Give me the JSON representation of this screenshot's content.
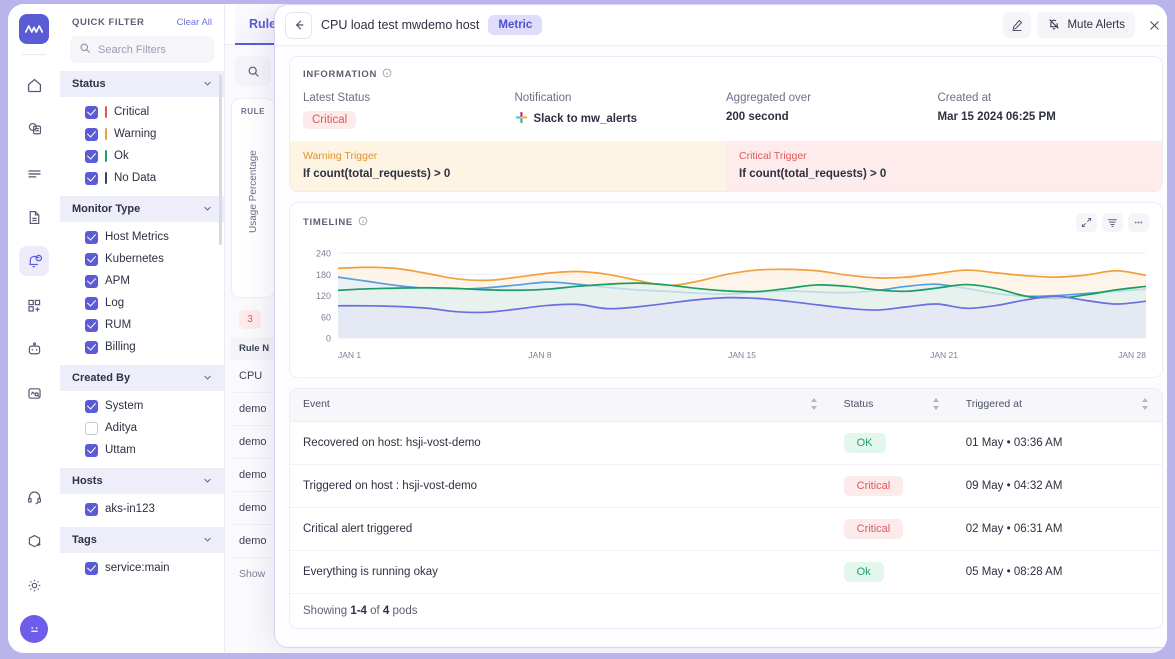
{
  "rail": {
    "logo": "mw-logo",
    "items": [
      {
        "name": "home-icon"
      },
      {
        "name": "infrastructure-icon"
      },
      {
        "name": "logs-icon"
      },
      {
        "name": "documents-icon"
      },
      {
        "name": "alerts-icon",
        "active": true
      },
      {
        "name": "add-widget-icon"
      },
      {
        "name": "bot-icon"
      },
      {
        "name": "synthetics-icon"
      }
    ],
    "bottom": [
      {
        "name": "support-headset-icon"
      },
      {
        "name": "add-package-icon"
      },
      {
        "name": "settings-gear-icon"
      }
    ],
    "avatar": "user-avatar"
  },
  "quick_filter": {
    "title": "QUICK FILTER",
    "clear_all": "Clear All",
    "search_placeholder": "Search Filters",
    "sections": [
      {
        "title": "Status",
        "items": [
          {
            "label": "Critical",
            "checked": true,
            "color": "#e0585b"
          },
          {
            "label": "Warning",
            "checked": true,
            "color": "#f0a132"
          },
          {
            "label": "Ok",
            "checked": true,
            "color": "#22a06b"
          },
          {
            "label": "No Data",
            "checked": true,
            "color": "#3d4255"
          }
        ]
      },
      {
        "title": "Monitor Type",
        "items": [
          {
            "label": "Host Metrics",
            "checked": true
          },
          {
            "label": "Kubernetes",
            "checked": true
          },
          {
            "label": "APM",
            "checked": true
          },
          {
            "label": "Log",
            "checked": true
          },
          {
            "label": "RUM",
            "checked": true
          },
          {
            "label": "Billing",
            "checked": true
          }
        ]
      },
      {
        "title": "Created By",
        "items": [
          {
            "label": "System",
            "checked": true
          },
          {
            "label": "Aditya",
            "checked": false
          },
          {
            "label": "Uttam",
            "checked": true
          }
        ]
      },
      {
        "title": "Hosts",
        "items": [
          {
            "label": "aks-in123",
            "checked": true
          }
        ]
      },
      {
        "title": "Tags",
        "items": [
          {
            "label": "service:main",
            "checked": true
          }
        ]
      }
    ]
  },
  "background": {
    "tab_label": "Rule",
    "card_caption": "RULE",
    "card_axis": "Usage Percentage",
    "badge_count": "3",
    "list_header": "Rule N",
    "list_rows": [
      "CPU",
      "demo",
      "demo",
      "demo",
      "demo",
      "demo"
    ],
    "list_footer": "Show"
  },
  "modal": {
    "back": "back-arrow",
    "title": "CPU load test mwdemo host",
    "type_pill": "Metric",
    "edit_label": "edit-pencil",
    "mute_label": "Mute Alerts",
    "close_label": "close",
    "information": {
      "caption": "INFORMATION",
      "fields": [
        {
          "label": "Latest Status",
          "value": "Critical",
          "kind": "badge-critical"
        },
        {
          "label": "Notification",
          "value": "Slack to mw_alerts",
          "kind": "slack"
        },
        {
          "label": "Aggregated over",
          "value": "200 second",
          "kind": "text"
        },
        {
          "label": "Created at",
          "value": "Mar 15 2024 06:25 PM",
          "kind": "text"
        }
      ],
      "triggers": [
        {
          "title": "Warning Trigger",
          "formula": "If count(total_requests) > 0",
          "kind": "warn"
        },
        {
          "title": "Critical Trigger",
          "formula": "If count(total_requests) > 0",
          "kind": "crit"
        }
      ]
    },
    "timeline": {
      "caption": "TIMELINE",
      "controls": [
        "expand-icon",
        "filter-lines-icon",
        "more-options-icon"
      ]
    },
    "events": {
      "columns": [
        "Event",
        "Status",
        "Triggered at"
      ],
      "rows": [
        {
          "event": "Recovered on host: hsji-vost-demo",
          "status": "OK",
          "status_kind": "ok",
          "triggered_at": "01 May • 03:36 AM"
        },
        {
          "event": "Triggered on host : hsji-vost-demo",
          "status": "Critical",
          "status_kind": "critical",
          "triggered_at": "09 May • 04:32 AM"
        },
        {
          "event": "Critical alert triggered",
          "status": "Critical",
          "status_kind": "critical",
          "triggered_at": "02 May • 06:31 AM"
        },
        {
          "event": "Everything is running okay",
          "status": "Ok",
          "status_kind": "ok",
          "triggered_at": "05 May • 08:28 AM"
        }
      ],
      "showing_prefix": "Showing ",
      "showing_range": "1-4",
      "showing_mid": " of ",
      "showing_total": "4",
      "showing_suffix": " pods"
    }
  },
  "chart_data": {
    "type": "area",
    "title": "TIMELINE",
    "xlabel": "",
    "ylabel": "",
    "ylim": [
      0,
      260
    ],
    "yticks": [
      0,
      60,
      120,
      180,
      240
    ],
    "xticks": [
      "JAN 1",
      "JAN 8",
      "JAN 15",
      "JAN 21",
      "JAN 28"
    ],
    "grid": true,
    "legend": "none",
    "x": [
      0,
      1,
      2,
      3,
      4,
      5,
      6,
      7,
      8,
      9,
      10,
      11,
      12,
      13,
      14,
      15,
      16,
      17,
      18,
      19,
      20,
      21,
      22,
      23,
      24,
      25,
      26,
      27
    ],
    "series": [
      {
        "name": "orange",
        "color": "#f2a03d",
        "fill": "#fdf1e2",
        "values": [
          197,
          200,
          196,
          182,
          167,
          163,
          172,
          183,
          188,
          180,
          163,
          148,
          160,
          180,
          192,
          194,
          190,
          178,
          170,
          172,
          182,
          192,
          184,
          176,
          172,
          178,
          190,
          177
        ]
      },
      {
        "name": "green",
        "color": "#1a9d63",
        "fill": "#e4f3ec",
        "values": [
          135,
          139,
          141,
          142,
          140,
          136,
          135,
          138,
          146,
          152,
          155,
          150,
          140,
          133,
          131,
          140,
          150,
          146,
          136,
          132,
          141,
          151,
          140,
          118,
          112,
          122,
          136,
          146
        ]
      },
      {
        "name": "blue",
        "color": "#539fe0",
        "fill": "#e3eff9",
        "values": [
          172,
          160,
          148,
          140,
          138,
          142,
          150,
          158,
          152,
          143,
          136,
          132,
          127,
          124,
          130,
          133,
          130,
          128,
          134,
          146,
          152,
          140,
          126,
          118,
          120,
          126,
          132,
          138
        ]
      },
      {
        "name": "purple",
        "color": "#6d6de0",
        "fill": "#e5e5f5",
        "values": [
          91,
          91,
          89,
          84,
          74,
          73,
          82,
          92,
          95,
          83,
          88,
          98,
          108,
          114,
          112,
          104,
          94,
          84,
          79,
          88,
          96,
          84,
          92,
          108,
          118,
          106,
          96,
          104,
          116
        ]
      }
    ]
  }
}
